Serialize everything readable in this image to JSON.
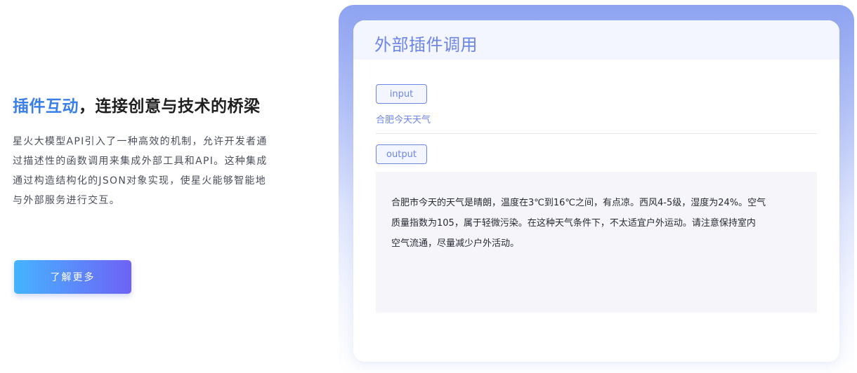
{
  "feature": {
    "heading_highlight": "插件互动",
    "heading_rest": "，连接创意与技术的桥梁",
    "description_lines": [
      "星火大模型API引入了一种高效的机制，允许开发者通",
      "过描述性的函数调用来集成外部工具和API。这种集成",
      "通过构造结构化的JSON对象实现，使星火能够智能地",
      "与外部服务进行交互。"
    ],
    "cta_label": "了解更多"
  },
  "demo": {
    "title": "外部插件调用",
    "input_tag": "input",
    "input_text": "合肥今天天气",
    "output_tag": "output",
    "output_lines": [
      "合肥市今天的天气是晴朗，温度在3℃到16℃之间，有点凉。西风4-5级，湿度为24%。空气",
      "质量指数为105，属于轻微污染。在这种天气条件下，不太适宜户外运动。请注意保持室内",
      "空气流通，尽量减少户外活动。"
    ]
  },
  "colors": {
    "heading_highlight": "#3a7fe8",
    "accent": "#6d85e8",
    "cta_gradient_start": "#45b4ff",
    "cta_gradient_end": "#6f62f6"
  }
}
